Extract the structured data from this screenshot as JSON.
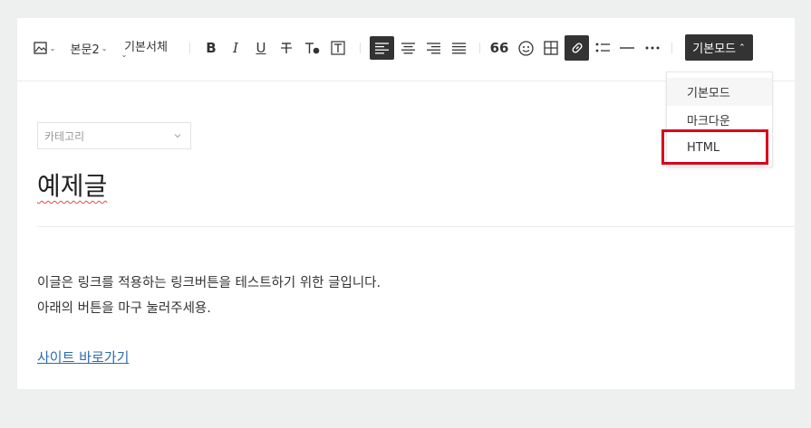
{
  "toolbar": {
    "paragraph_label": "본문2",
    "font_label": "기본서체",
    "mode_button_label": "기본모드",
    "mode_caret": "⌃"
  },
  "mode_menu": {
    "items": [
      "기본모드",
      "마크다운",
      "HTML"
    ]
  },
  "category": {
    "label": "카테고리"
  },
  "post": {
    "title": "예제글",
    "lines": [
      "이글은 링크를 적용하는 링크버튼을 테스트하기 위한 글입니다.",
      "아래의 버튼을 마구 눌러주세용."
    ],
    "link_text": "사이트 바로가기"
  },
  "colors": {
    "accent_dark": "#333333",
    "highlight": "#d9001b",
    "link": "#2b6cb0"
  }
}
